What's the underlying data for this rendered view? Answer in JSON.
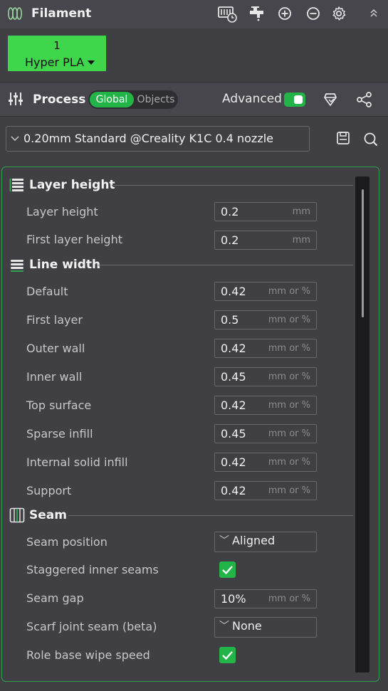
{
  "filament": {
    "title": "Filament",
    "icons": [
      "filament-logo-icon",
      "printer-sync-icon",
      "faucet-icon",
      "add-circle-icon",
      "remove-circle-icon",
      "gear-icon",
      "collapse-chevron-icon"
    ],
    "slot": {
      "index": "1",
      "name": "Hyper PLA",
      "color": "#3fd64b"
    }
  },
  "process": {
    "title": "Process",
    "toggle": {
      "global": "Global",
      "objects": "Objects",
      "active": "global"
    },
    "advanced_label": "Advanced",
    "advanced_on": true,
    "preset": "0.20mm Standard @Creality K1C 0.4 nozzle",
    "accent": "#22b448"
  },
  "sections": {
    "layer_height": {
      "title": "Layer height",
      "rows": [
        {
          "label": "Layer height",
          "value": "0.2",
          "unit": "mm"
        },
        {
          "label": "First layer height",
          "value": "0.2",
          "unit": "mm"
        }
      ]
    },
    "line_width": {
      "title": "Line width",
      "rows": [
        {
          "label": "Default",
          "value": "0.42",
          "unit": "mm or %"
        },
        {
          "label": "First layer",
          "value": "0.5",
          "unit": "mm or %"
        },
        {
          "label": "Outer wall",
          "value": "0.42",
          "unit": "mm or %"
        },
        {
          "label": "Inner wall",
          "value": "0.45",
          "unit": "mm or %"
        },
        {
          "label": "Top surface",
          "value": "0.42",
          "unit": "mm or %"
        },
        {
          "label": "Sparse infill",
          "value": "0.45",
          "unit": "mm or %"
        },
        {
          "label": "Internal solid infill",
          "value": "0.42",
          "unit": "mm or %"
        },
        {
          "label": "Support",
          "value": "0.42",
          "unit": "mm or %"
        }
      ]
    },
    "seam": {
      "title": "Seam",
      "seam_position": {
        "label": "Seam position",
        "value": "Aligned"
      },
      "staggered": {
        "label": "Staggered inner seams",
        "checked": true
      },
      "seam_gap": {
        "label": "Seam gap",
        "value": "10%",
        "unit": "mm or %"
      },
      "scarf": {
        "label": "Scarf joint seam (beta)",
        "value": "None"
      },
      "role_wipe": {
        "label": "Role base wipe speed",
        "checked": true
      }
    }
  }
}
